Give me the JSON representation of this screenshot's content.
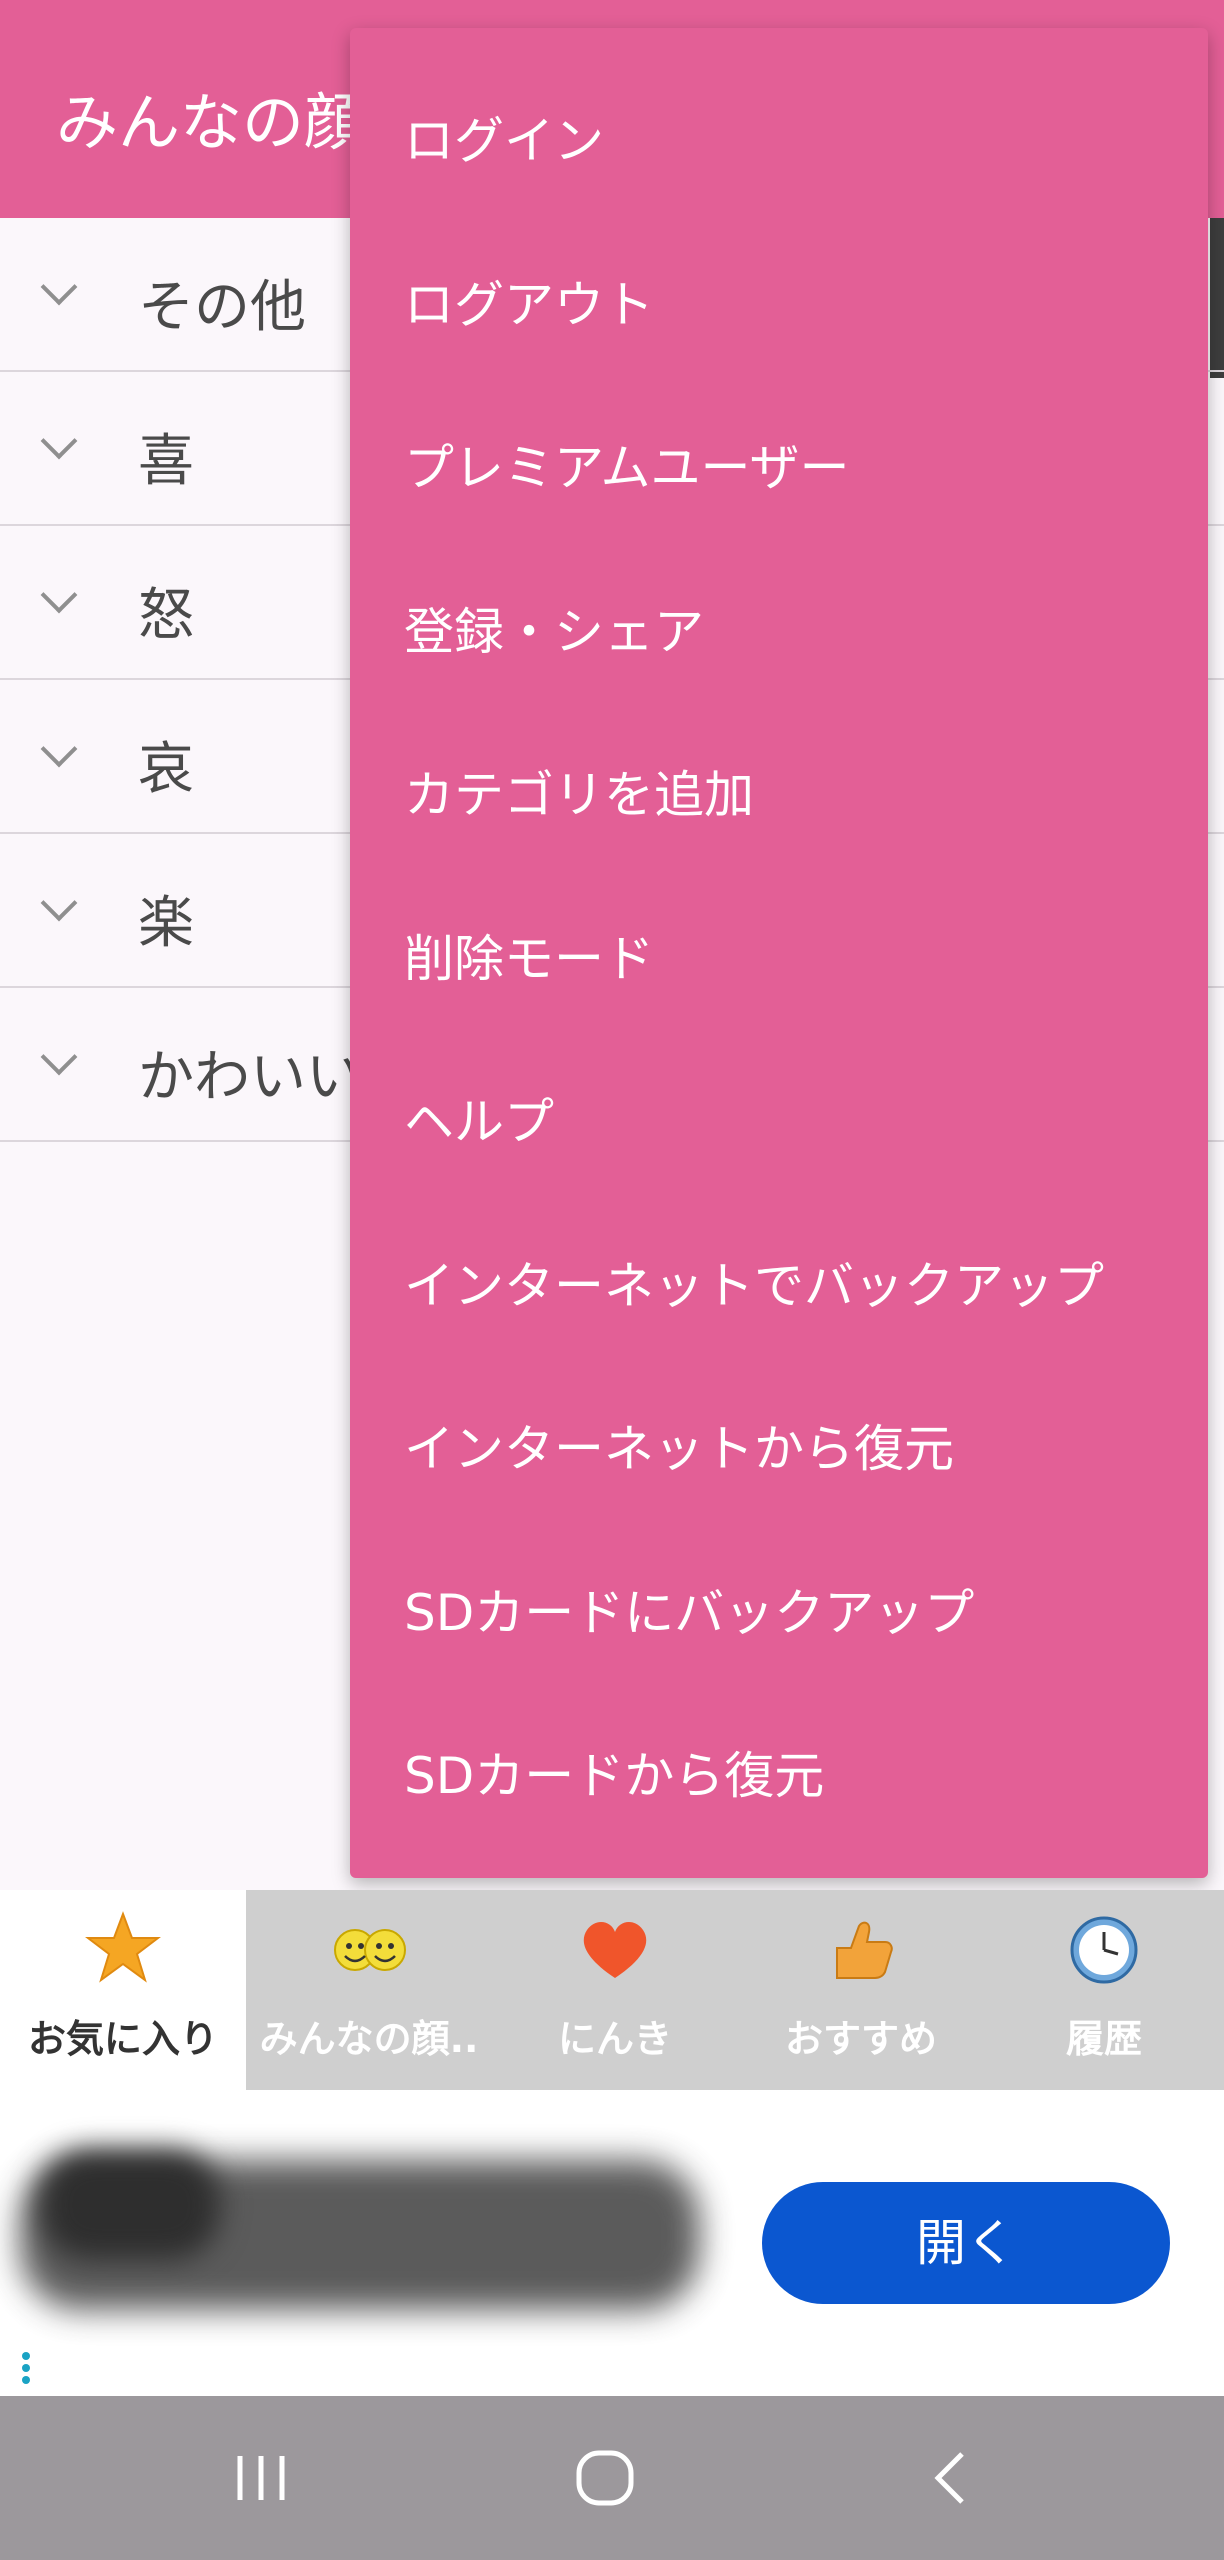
{
  "app_bar": {
    "title": "みんなの顔"
  },
  "categories": [
    {
      "label": "その他"
    },
    {
      "label": "喜"
    },
    {
      "label": "怒"
    },
    {
      "label": "哀"
    },
    {
      "label": "楽"
    },
    {
      "label": "かわいい"
    }
  ],
  "menu": {
    "items": [
      {
        "label": "ログイン"
      },
      {
        "label": "ログアウト"
      },
      {
        "label": "プレミアムユーザー"
      },
      {
        "label": "登録・シェア"
      },
      {
        "label": "カテゴリを追加"
      },
      {
        "label": "削除モード"
      },
      {
        "label": "ヘルプ"
      },
      {
        "label": "インターネットでバックアップ"
      },
      {
        "label": "インターネットから復元"
      },
      {
        "label": "SDカードにバックアップ"
      },
      {
        "label": "SDカードから復元"
      }
    ]
  },
  "tabs": [
    {
      "label": "お気に入り",
      "icon": "star-icon",
      "active": true
    },
    {
      "label": "みんなの顔..",
      "icon": "faces-icon",
      "active": false
    },
    {
      "label": "にんき",
      "icon": "heart-icon",
      "active": false
    },
    {
      "label": "おすすめ",
      "icon": "thumbs-up-icon",
      "active": false
    },
    {
      "label": "履歴",
      "icon": "clock-icon",
      "active": false
    }
  ],
  "ad": {
    "button_label": "開く"
  },
  "colors": {
    "primary": "#e35f96",
    "ad_button": "#0b57d0",
    "tab_bar": "#cfcfcf",
    "system_nav": "#9c989c"
  }
}
